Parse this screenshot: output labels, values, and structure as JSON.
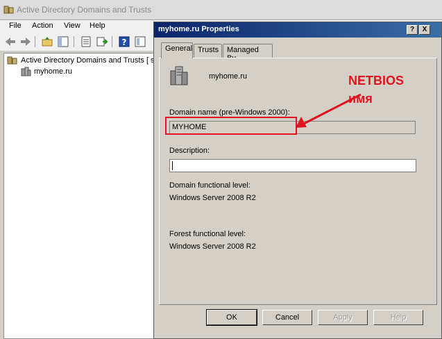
{
  "main_window": {
    "title": "Active Directory Domains and Trusts",
    "menu": [
      "File",
      "Action",
      "View",
      "Help"
    ]
  },
  "tree": {
    "root_label": "Active Directory Domains and Trusts [ s",
    "child_label": "myhome.ru"
  },
  "dialog": {
    "title": "myhome.ru Properties",
    "help_button": "?",
    "close_button": "X",
    "tabs": [
      "General",
      "Trusts",
      "Managed By"
    ],
    "active_tab": "General",
    "domain_name_display": "myhome.ru",
    "pre2000_label": "Domain name (pre-Windows 2000):",
    "pre2000_value": "MYHOME",
    "description_label": "Description:",
    "description_value": "",
    "domain_level_label": "Domain functional level:",
    "domain_level_value": "Windows Server 2008 R2",
    "forest_level_label": "Forest functional level:",
    "forest_level_value": "Windows Server 2008 R2",
    "buttons": {
      "ok": "OK",
      "cancel": "Cancel",
      "apply": "Apply",
      "help": "Help"
    }
  },
  "annotation": {
    "line1": "NETBIOS",
    "line2": "имя",
    "color": "#e0141e"
  }
}
